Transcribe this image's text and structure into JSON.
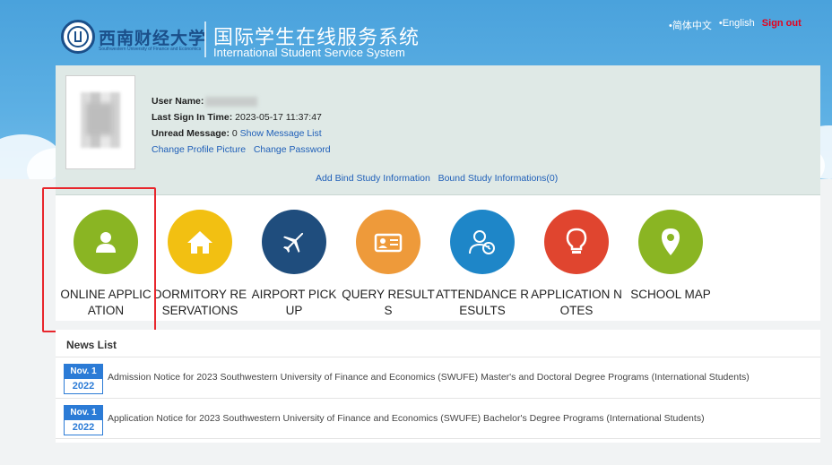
{
  "header": {
    "logo_cn": "西南财经大学",
    "logo_en": "Southwestern University of Finance and Economics",
    "title_cn": "国际学生在线服务系统",
    "title_en": "International Student Service System",
    "links": [
      {
        "label": "•简体中文"
      },
      {
        "label": "•English"
      }
    ],
    "signout": "Sign out"
  },
  "profile": {
    "username_label": "User Name:",
    "last_sign_label": "Last Sign In Time:",
    "last_sign_value": "2023-05-17 11:37:47",
    "unread_label": "Unread Message:",
    "unread_value": "0",
    "show_messages": "Show Message List",
    "change_picture": "Change Profile Picture",
    "change_password": "Change Password",
    "add_bind": "Add Bind Study Information",
    "bound_info": "Bound Study Informations(0)"
  },
  "services": [
    {
      "label": "ONLINE APPLICATION",
      "color": "#8ab523",
      "icon": "user-icon"
    },
    {
      "label": "DORMITORY RESERVATIONS",
      "color": "#f2c012",
      "icon": "house-icon"
    },
    {
      "label": "AIRPORT PICK UP",
      "color": "#1f4d7d",
      "icon": "airplane-icon"
    },
    {
      "label": "QUERY RESULTS",
      "color": "#ee9a3a",
      "icon": "id-card-icon"
    },
    {
      "label": "ATTENDANCE RESULTS",
      "color": "#1e86c8",
      "icon": "person-clock-icon"
    },
    {
      "label": "APPLICATION NOTES",
      "color": "#e0452f",
      "icon": "lightbulb-icon"
    },
    {
      "label": "SCHOOL MAP",
      "color": "#8ab523",
      "icon": "map-pin-icon"
    }
  ],
  "news": {
    "title": "News List",
    "items": [
      {
        "month_day": "Nov. 1",
        "year": "2022",
        "text": "Admission Notice for 2023 Southwestern University of Finance and Economics (SWUFE) Master's and Doctoral Degree Programs (International Students)"
      },
      {
        "month_day": "Nov. 1",
        "year": "2022",
        "text": "Application Notice for 2023 Southwestern University of Finance and Economics (SWUFE) Bachelor's Degree Programs (International Students)"
      }
    ]
  }
}
